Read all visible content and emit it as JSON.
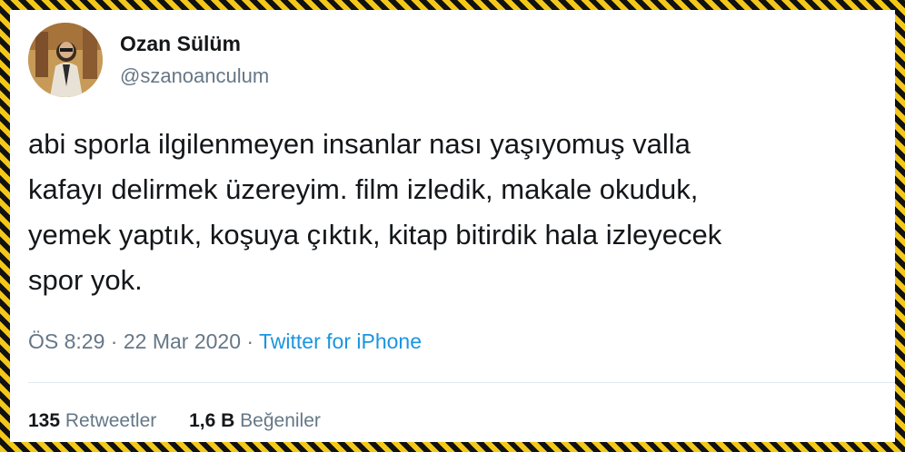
{
  "user": {
    "name": "Ozan Sülüm",
    "handle": "@szanoanculum"
  },
  "tweet": {
    "lines": [
      "abi sporla ilgilenmeyen insanlar nası yaşıyomuş valla",
      "kafayı delirmek üzereyim. film izledik, makale okuduk,",
      "yemek yaptık, koşuya çıktık, kitap bitirdik hala izleyecek",
      "spor yok."
    ],
    "time": "ÖS 8:29",
    "separator": "·",
    "date": "22 Mar 2020",
    "source": "Twitter for iPhone"
  },
  "stats": {
    "retweets_count": "135",
    "retweets_label": "Retweetler",
    "likes_count": "1,6 B",
    "likes_label": "Beğeniler"
  },
  "colors": {
    "text": "#14171a",
    "secondary": "#657786",
    "link": "#1b95e0",
    "border_stripe_yellow": "#f4c81a",
    "border_stripe_black": "#111111"
  }
}
